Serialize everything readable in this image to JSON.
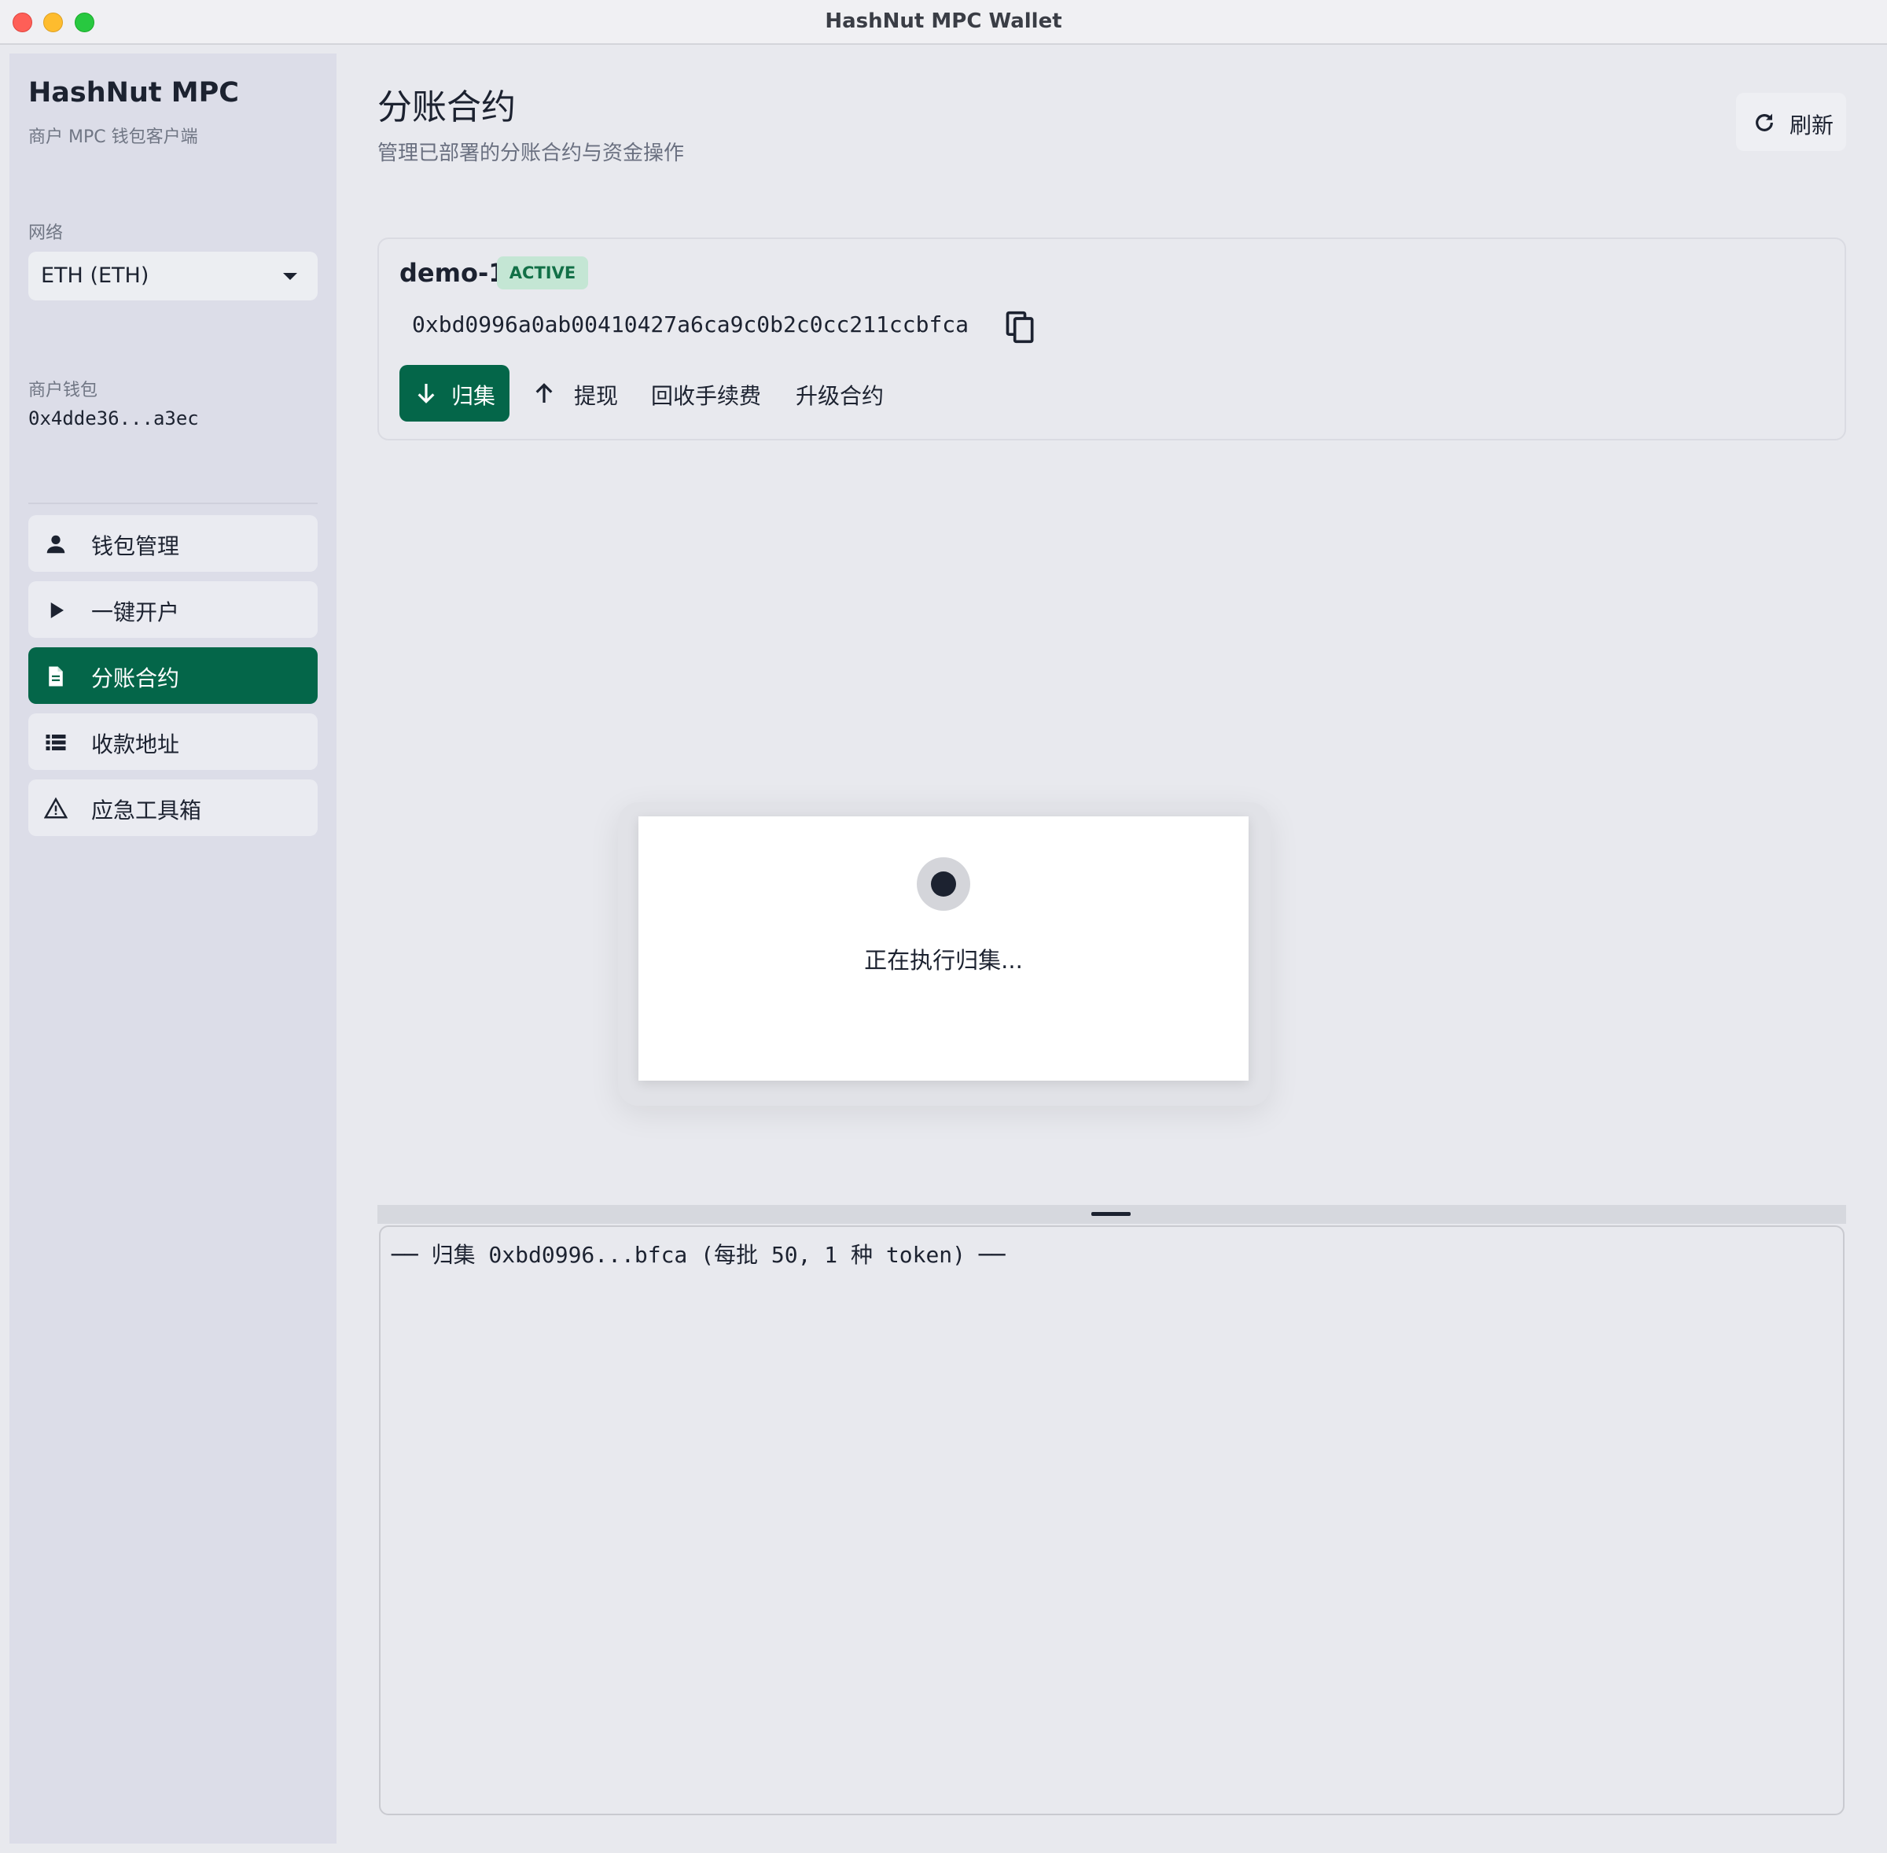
{
  "window": {
    "title": "HashNut MPC Wallet"
  },
  "sidebar": {
    "brand": "HashNut MPC",
    "brand_subtitle": "商户 MPC 钱包客户端",
    "network_label": "网络",
    "network_value": "ETH (ETH)",
    "wallet_label": "商户钱包",
    "wallet_address": "0x4dde36...a3ec",
    "items": [
      {
        "label": "钱包管理",
        "icon": "person-icon"
      },
      {
        "label": "一键开户",
        "icon": "play-icon"
      },
      {
        "label": "分账合约",
        "icon": "document-icon",
        "active": true
      },
      {
        "label": "收款地址",
        "icon": "list-icon"
      },
      {
        "label": "应急工具箱",
        "icon": "warning-icon"
      }
    ]
  },
  "header": {
    "title": "分账合约",
    "subtitle": "管理已部署的分账合约与资金操作",
    "refresh_label": "刷新"
  },
  "contract": {
    "name": "demo-1",
    "status": "ACTIVE",
    "address": "0xbd0996a0ab00410427a6ca9c0b2c0cc211ccbfca",
    "actions": {
      "collect": "归集",
      "withdraw": "提现",
      "reclaim_fee": "回收手续费",
      "upgrade": "升级合约"
    }
  },
  "modal": {
    "message": "正在执行归集..."
  },
  "log": {
    "lines": [
      "── 归集 0xbd0996...bfca (每批 50, 1 种 token) ──"
    ]
  },
  "colors": {
    "accent": "#046649",
    "badge_bg": "#c4e6d4",
    "badge_text": "#127047",
    "sidebar_bg": "#dcdde8",
    "main_bg": "#e8e9ee"
  }
}
